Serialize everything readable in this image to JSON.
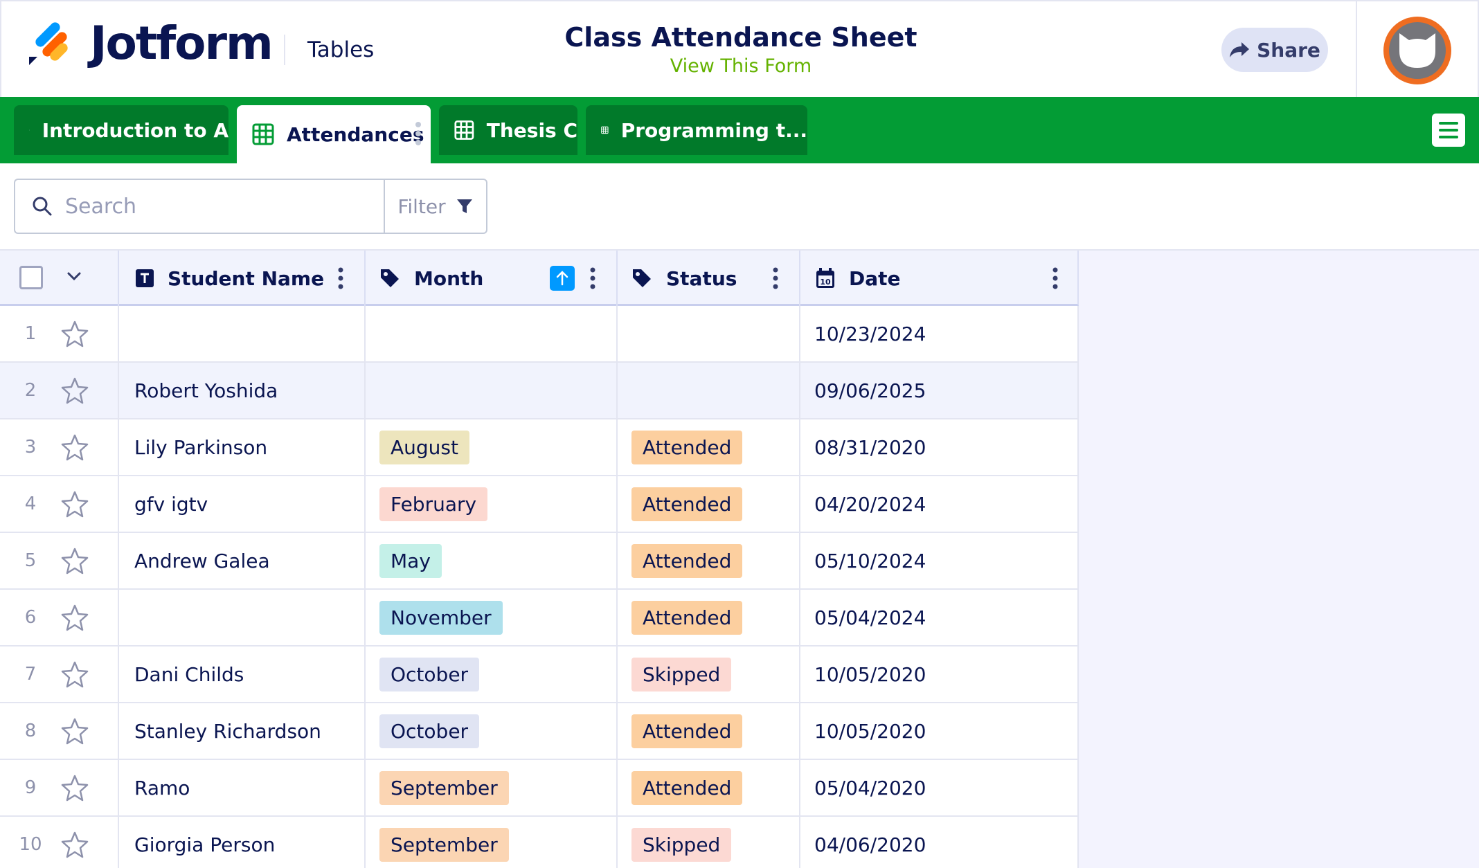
{
  "header": {
    "brand": "Jotform",
    "section": "Tables",
    "form_title": "Class Attendance Sheet",
    "form_link": "View This Form",
    "share_label": "Share",
    "accent_green": "#039c35",
    "link_green": "#64b200"
  },
  "tabs": [
    {
      "label": "Introduction to A",
      "active": false
    },
    {
      "label": "Attendances",
      "active": true
    },
    {
      "label": "Thesis C",
      "active": false
    },
    {
      "label": "Programming t...",
      "active": false
    }
  ],
  "toolbar": {
    "search_placeholder": "Search",
    "filter_label": "Filter"
  },
  "columns": {
    "name": "Student Name",
    "month": "Month",
    "status": "Status",
    "date": "Date",
    "month_sort": "ascending"
  },
  "rows": [
    {
      "num": "1",
      "name": "",
      "month": "",
      "status": "",
      "date": "10/23/2024"
    },
    {
      "num": "2",
      "name": "Robert Yoshida",
      "month": "",
      "status": "",
      "date": "09/06/2025"
    },
    {
      "num": "3",
      "name": "Lily Parkinson",
      "month": "August",
      "status": "Attended",
      "date": "08/31/2020"
    },
    {
      "num": "4",
      "name": "gfv igtv",
      "month": "February",
      "status": "Attended",
      "date": "04/20/2024"
    },
    {
      "num": "5",
      "name": "Andrew Galea",
      "month": "May",
      "status": "Attended",
      "date": "05/10/2024"
    },
    {
      "num": "6",
      "name": "",
      "month": "November",
      "status": "Attended",
      "date": "05/04/2024"
    },
    {
      "num": "7",
      "name": "Dani Childs",
      "month": "October",
      "status": "Skipped",
      "date": "10/05/2020"
    },
    {
      "num": "8",
      "name": "Stanley Richardson",
      "month": "October",
      "status": "Attended",
      "date": "10/05/2020"
    },
    {
      "num": "9",
      "name": "Ramo",
      "month": "September",
      "status": "Attended",
      "date": "05/04/2020"
    },
    {
      "num": "10",
      "name": "Giorgia Person",
      "month": "September",
      "status": "Skipped",
      "date": "04/06/2020"
    }
  ],
  "tag_colors": {
    "August": "#ede5bd",
    "February": "#fcd8d0",
    "May": "#c4f0e8",
    "November": "#aee0ec",
    "October": "#e0e4f3",
    "September": "#fbd5b3",
    "Attended": "#fccf9f",
    "Skipped": "#fcd9d3"
  }
}
